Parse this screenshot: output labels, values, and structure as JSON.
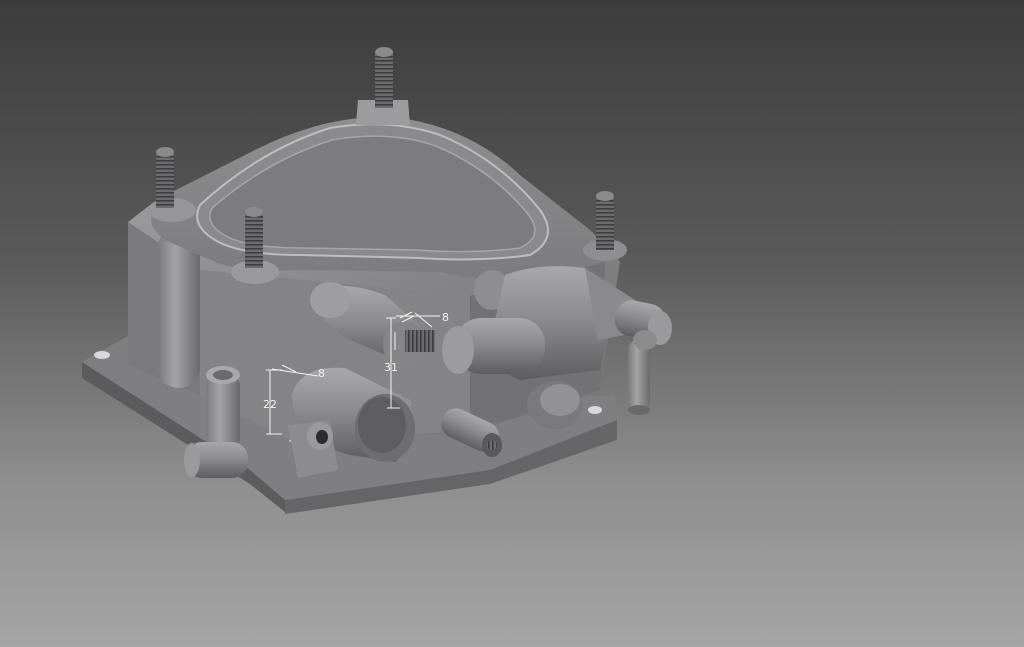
{
  "viewport": {
    "background_top": "#3c3c3c",
    "background_bottom": "#a5a5a5",
    "model_color": "#8a8a8c",
    "dimension_color": "#f2f2f2"
  },
  "dimensions": {
    "dim_8_top": "8",
    "dim_31": "31",
    "dim_8_left": "8",
    "dim_22": "22"
  }
}
